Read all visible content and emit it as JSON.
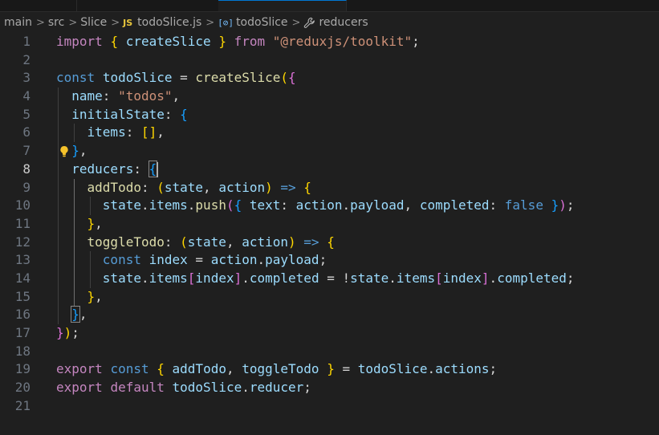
{
  "breadcrumb": {
    "items": [
      {
        "label": "main"
      },
      {
        "label": "src"
      },
      {
        "label": "Slice"
      },
      {
        "label": "todoSlice.js",
        "icon": "js-file-icon"
      },
      {
        "label": "todoSlice",
        "icon": "variable-symbol-icon"
      },
      {
        "label": "reducers",
        "icon": "wrench-icon"
      }
    ],
    "js_icon_text": "JS",
    "var_icon_text": "[⊘]",
    "separator": ">"
  },
  "editor": {
    "current_line": 8,
    "line_numbers": [
      "1",
      "2",
      "3",
      "4",
      "5",
      "6",
      "7",
      "8",
      "9",
      "10",
      "11",
      "12",
      "13",
      "14",
      "15",
      "16",
      "17",
      "18",
      "19",
      "20",
      "21"
    ],
    "lines": [
      [
        [
          "kw2",
          "import"
        ],
        [
          "op",
          " "
        ],
        [
          "b1",
          "{"
        ],
        [
          "op",
          " "
        ],
        [
          "var",
          "createSlice"
        ],
        [
          "op",
          " "
        ],
        [
          "b1",
          "}"
        ],
        [
          "op",
          " "
        ],
        [
          "kw2",
          "from"
        ],
        [
          "op",
          " "
        ],
        [
          "str",
          "\"@reduxjs/toolkit\""
        ],
        [
          "op",
          ";"
        ]
      ],
      [],
      [
        [
          "kw",
          "const"
        ],
        [
          "op",
          " "
        ],
        [
          "var",
          "todoSlice"
        ],
        [
          "op",
          " = "
        ],
        [
          "fn",
          "createSlice"
        ],
        [
          "b1",
          "("
        ],
        [
          "b2",
          "{"
        ]
      ],
      [
        [
          "op",
          "  "
        ],
        [
          "var",
          "name"
        ],
        [
          "op",
          ": "
        ],
        [
          "str",
          "\"todos\""
        ],
        [
          "op",
          ","
        ]
      ],
      [
        [
          "op",
          "  "
        ],
        [
          "var",
          "initialState"
        ],
        [
          "op",
          ": "
        ],
        [
          "b3",
          "{"
        ]
      ],
      [
        [
          "op",
          "    "
        ],
        [
          "var",
          "items"
        ],
        [
          "op",
          ": "
        ],
        [
          "b1",
          "[]"
        ],
        [
          "op",
          ","
        ]
      ],
      [
        [
          "op",
          "  "
        ],
        [
          "b3",
          "}"
        ],
        [
          "op",
          ","
        ]
      ],
      [
        [
          "op",
          "  "
        ],
        [
          "var",
          "reducers"
        ],
        [
          "op",
          ": "
        ],
        [
          "b3bm",
          "{"
        ]
      ],
      [
        [
          "op",
          "    "
        ],
        [
          "fn",
          "addTodo"
        ],
        [
          "op",
          ": "
        ],
        [
          "b1",
          "("
        ],
        [
          "var",
          "state"
        ],
        [
          "op",
          ", "
        ],
        [
          "var",
          "action"
        ],
        [
          "b1",
          ")"
        ],
        [
          "op",
          " "
        ],
        [
          "kw",
          "=>"
        ],
        [
          "op",
          " "
        ],
        [
          "b1",
          "{"
        ]
      ],
      [
        [
          "op",
          "      "
        ],
        [
          "var",
          "state"
        ],
        [
          "op",
          "."
        ],
        [
          "var",
          "items"
        ],
        [
          "op",
          "."
        ],
        [
          "fn",
          "push"
        ],
        [
          "b2",
          "("
        ],
        [
          "b3",
          "{"
        ],
        [
          "op",
          " "
        ],
        [
          "var",
          "text"
        ],
        [
          "op",
          ": "
        ],
        [
          "var",
          "action"
        ],
        [
          "op",
          "."
        ],
        [
          "var",
          "payload"
        ],
        [
          "op",
          ", "
        ],
        [
          "var",
          "completed"
        ],
        [
          "op",
          ": "
        ],
        [
          "kw",
          "false"
        ],
        [
          "op",
          " "
        ],
        [
          "b3",
          "}"
        ],
        [
          "b2",
          ")"
        ],
        [
          "op",
          ";"
        ]
      ],
      [
        [
          "op",
          "    "
        ],
        [
          "b1",
          "}"
        ],
        [
          "op",
          ","
        ]
      ],
      [
        [
          "op",
          "    "
        ],
        [
          "fn",
          "toggleTodo"
        ],
        [
          "op",
          ": "
        ],
        [
          "b1",
          "("
        ],
        [
          "var",
          "state"
        ],
        [
          "op",
          ", "
        ],
        [
          "var",
          "action"
        ],
        [
          "b1",
          ")"
        ],
        [
          "op",
          " "
        ],
        [
          "kw",
          "=>"
        ],
        [
          "op",
          " "
        ],
        [
          "b1",
          "{"
        ]
      ],
      [
        [
          "op",
          "      "
        ],
        [
          "kw",
          "const"
        ],
        [
          "op",
          " "
        ],
        [
          "var",
          "index"
        ],
        [
          "op",
          " = "
        ],
        [
          "var",
          "action"
        ],
        [
          "op",
          "."
        ],
        [
          "var",
          "payload"
        ],
        [
          "op",
          ";"
        ]
      ],
      [
        [
          "op",
          "      "
        ],
        [
          "var",
          "state"
        ],
        [
          "op",
          "."
        ],
        [
          "var",
          "items"
        ],
        [
          "b2",
          "["
        ],
        [
          "var",
          "index"
        ],
        [
          "b2",
          "]"
        ],
        [
          "op",
          "."
        ],
        [
          "var",
          "completed"
        ],
        [
          "op",
          " = !"
        ],
        [
          "var",
          "state"
        ],
        [
          "op",
          "."
        ],
        [
          "var",
          "items"
        ],
        [
          "b2",
          "["
        ],
        [
          "var",
          "index"
        ],
        [
          "b2",
          "]"
        ],
        [
          "op",
          "."
        ],
        [
          "var",
          "completed"
        ],
        [
          "op",
          ";"
        ]
      ],
      [
        [
          "op",
          "    "
        ],
        [
          "b1",
          "}"
        ],
        [
          "op",
          ","
        ]
      ],
      [
        [
          "op",
          "  "
        ],
        [
          "b3bm",
          "}"
        ],
        [
          "op",
          ","
        ]
      ],
      [
        [
          "b2",
          "}"
        ],
        [
          "b1",
          ")"
        ],
        [
          "op",
          ";"
        ]
      ],
      [],
      [
        [
          "kw2",
          "export"
        ],
        [
          "op",
          " "
        ],
        [
          "kw",
          "const"
        ],
        [
          "op",
          " "
        ],
        [
          "b1",
          "{"
        ],
        [
          "op",
          " "
        ],
        [
          "var",
          "addTodo"
        ],
        [
          "op",
          ", "
        ],
        [
          "var",
          "toggleTodo"
        ],
        [
          "op",
          " "
        ],
        [
          "b1",
          "}"
        ],
        [
          "op",
          " = "
        ],
        [
          "var",
          "todoSlice"
        ],
        [
          "op",
          "."
        ],
        [
          "var",
          "actions"
        ],
        [
          "op",
          ";"
        ]
      ],
      [
        [
          "kw2",
          "export"
        ],
        [
          "op",
          " "
        ],
        [
          "kw2",
          "default"
        ],
        [
          "op",
          " "
        ],
        [
          "var",
          "todoSlice"
        ],
        [
          "op",
          "."
        ],
        [
          "var",
          "reducer"
        ],
        [
          "op",
          ";"
        ]
      ],
      []
    ]
  },
  "colors": {
    "background": "#1f1f1f",
    "keyword": "#569cd6",
    "control_keyword": "#c586c0",
    "function": "#dcdcaa",
    "variable": "#9cdcfe",
    "string": "#ce9178",
    "bracket_level1": "#ffd700",
    "bracket_level2": "#da70d6",
    "bracket_level3": "#179fff",
    "lightbulb": "#f5c22b"
  }
}
